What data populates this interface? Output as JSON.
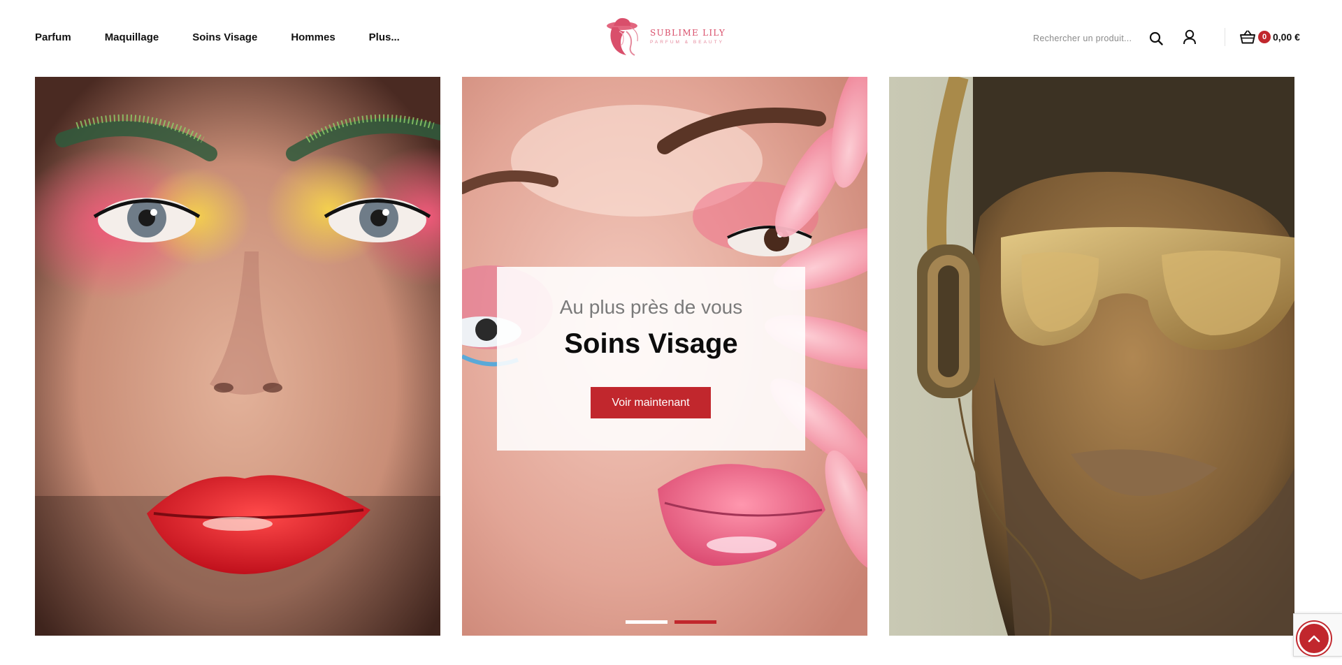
{
  "header": {
    "nav": [
      {
        "label": "Parfum"
      },
      {
        "label": "Maquillage"
      },
      {
        "label": "Soins Visage"
      },
      {
        "label": "Hommes"
      },
      {
        "label": "Plus..."
      }
    ],
    "logo": {
      "name": "SUBLIME LILY",
      "tagline": "PARFUM & BEAUTY"
    },
    "search": {
      "placeholder": "Rechercher un produit..."
    },
    "cart": {
      "count": "0",
      "total": "0,00 €"
    }
  },
  "hero": {
    "subtitle": "Au plus près de vous",
    "title": "Soins Visage",
    "button_label": "Voir maintenant",
    "slides": [
      {
        "active": false
      },
      {
        "active": true
      }
    ]
  },
  "colors": {
    "accent": "#c1272d",
    "logo_pink": "#d94f6b",
    "dot_inactive": "#ffffff"
  },
  "icons": [
    "search-icon",
    "user-icon",
    "basket-icon",
    "chevron-up-icon",
    "recaptcha-icon"
  ]
}
